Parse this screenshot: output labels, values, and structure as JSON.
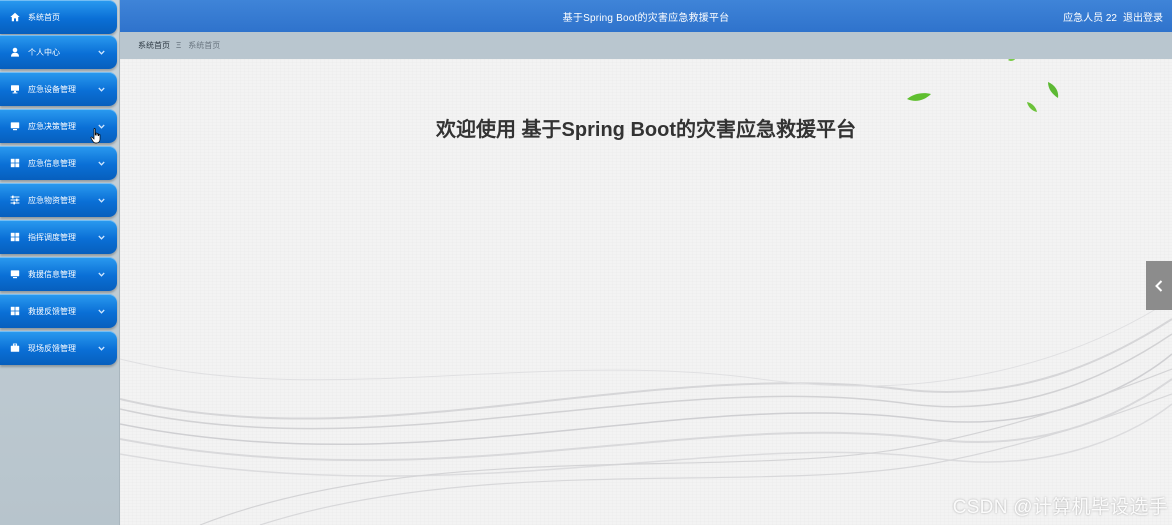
{
  "header": {
    "title": "基于Spring Boot的灾害应急救援平台",
    "user": "应急人员 22",
    "logout": "退出登录"
  },
  "breadcrumb": {
    "home": "系统首页",
    "separator": "Ξ",
    "current": "系统首页"
  },
  "sidebar": {
    "items": [
      {
        "label": "系统首页",
        "icon": "home-icon",
        "has_submenu": false
      },
      {
        "label": "个人中心",
        "icon": "user-icon",
        "has_submenu": true
      },
      {
        "label": "应急设备管理",
        "icon": "device-icon",
        "has_submenu": true
      },
      {
        "label": "应急决策管理",
        "icon": "monitor-icon",
        "has_submenu": true
      },
      {
        "label": "应急信息管理",
        "icon": "grid-icon",
        "has_submenu": true
      },
      {
        "label": "应急物资管理",
        "icon": "sliders-icon",
        "has_submenu": true
      },
      {
        "label": "指挥调度管理",
        "icon": "grid-icon",
        "has_submenu": true
      },
      {
        "label": "救援信息管理",
        "icon": "monitor-icon",
        "has_submenu": true
      },
      {
        "label": "救援反馈管理",
        "icon": "grid-icon",
        "has_submenu": true
      },
      {
        "label": "现场反馈管理",
        "icon": "briefcase-icon",
        "has_submenu": true
      }
    ]
  },
  "main": {
    "welcome": "欢迎使用 基于Spring Boot的灾害应急救援平台"
  },
  "watermark": "CSDN @计算机毕设选手",
  "colors": {
    "header": "#3a7fd5",
    "nav_button": "#0a6fd6",
    "breadcrumb_bg": "#b9c6cf",
    "main_bg": "#f3f3f3",
    "leaf": "#5fbf2f"
  }
}
